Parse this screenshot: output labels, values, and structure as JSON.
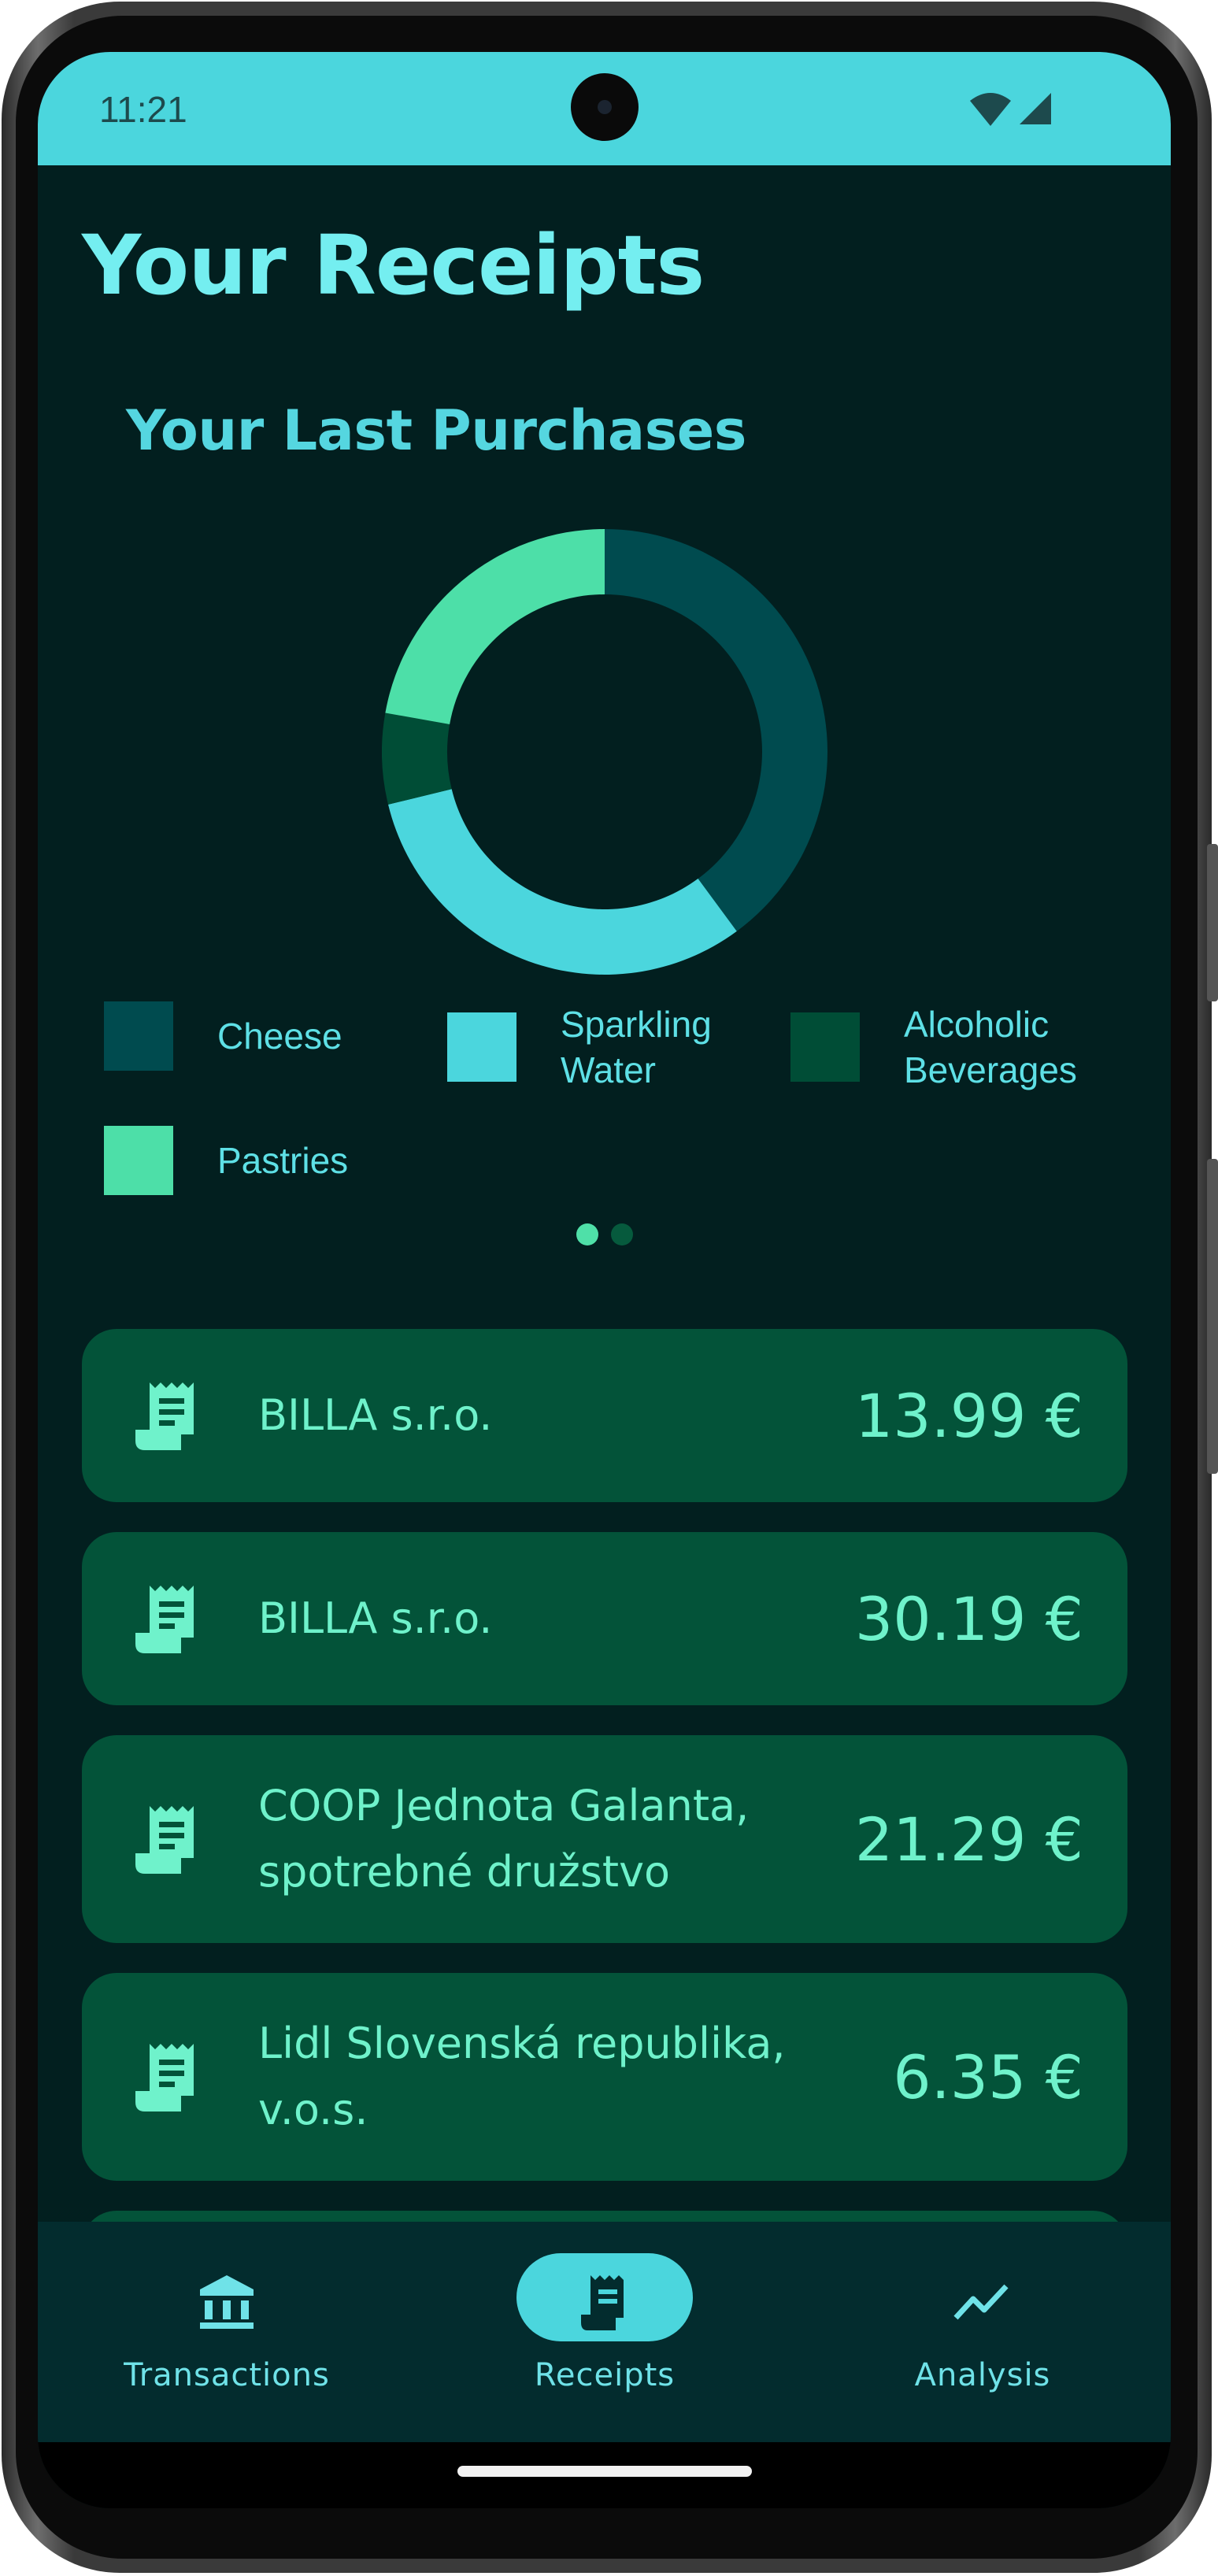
{
  "status_bar": {
    "time": "11:21"
  },
  "page": {
    "title": "Your Receipts"
  },
  "purchases": {
    "title": "Your Last Purchases",
    "page_indicator": {
      "count": 2,
      "active": 0,
      "colors": {
        "active": "#4fe0a8",
        "inactive": "#065a3d"
      }
    }
  },
  "chart_data": {
    "type": "pie",
    "variant": "donut",
    "title": "Your Last Purchases",
    "series": [
      {
        "name": "Cheese",
        "value": 39.9,
        "color": "#004b4f"
      },
      {
        "name": "Sparkling Water",
        "value": 31.3,
        "color": "#4bd6dd"
      },
      {
        "name": "Alcoholic Beverages",
        "value": 6.6,
        "color": "#004d36"
      },
      {
        "name": "Pastries",
        "value": 22.2,
        "color": "#4ddfa8"
      }
    ],
    "legend": {
      "placement": "bottom"
    }
  },
  "receipts": [
    {
      "merchant": "BILLA s.r.o.",
      "amount": "13.99 €"
    },
    {
      "merchant": "BILLA s.r.o.",
      "amount": "30.19 €"
    },
    {
      "merchant": "COOP Jednota Galanta, spotrebné družstvo",
      "amount": "21.29 €"
    },
    {
      "merchant": "Lidl Slovenská republika, v.o.s.",
      "amount": "6.35 €"
    }
  ],
  "nav": {
    "items": [
      {
        "label": "Transactions",
        "icon": "bank-icon",
        "active": false
      },
      {
        "label": "Receipts",
        "icon": "receipt-icon",
        "active": true
      },
      {
        "label": "Analysis",
        "icon": "trending-up-icon",
        "active": false
      }
    ]
  },
  "colors": {
    "background": "#021f1f",
    "status_bar": "#4bd6dd",
    "card": "#035339",
    "card_text": "#6ff2cb",
    "nav_background": "#032c2e",
    "nav_active_pill": "#4bd6dd"
  }
}
